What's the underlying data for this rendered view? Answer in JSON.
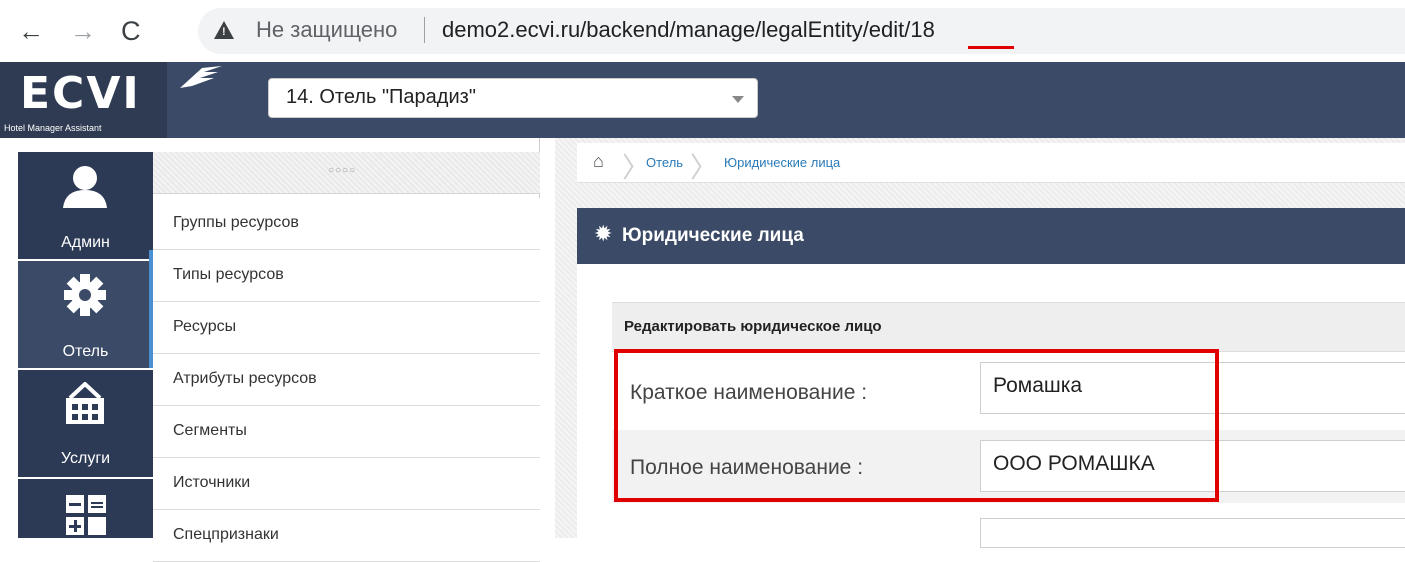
{
  "browser": {
    "back": "←",
    "forward": "→",
    "reload": "C",
    "security_label": "Не защищено",
    "url": "demo2.ecvi.ru/backend/manage/legalEntity/edit/18"
  },
  "header": {
    "logo": "ECVI",
    "logo_sub": "Hotel Manager Assistant",
    "hotel_select": "14. Отель \"Парадиз\""
  },
  "rail": {
    "items": [
      {
        "label": "Админ",
        "icon": "user-icon"
      },
      {
        "label": "Отель",
        "icon": "gear-icon"
      },
      {
        "label": "Услуги",
        "icon": "basket-icon"
      },
      {
        "label": "",
        "icon": "calculator-icon"
      }
    ]
  },
  "submenu": {
    "items": [
      {
        "label": "Группы ресурсов"
      },
      {
        "label": "Типы ресурсов"
      },
      {
        "label": "Ресурсы"
      },
      {
        "label": "Атрибуты ресурсов"
      },
      {
        "label": "Сегменты"
      },
      {
        "label": "Источники"
      },
      {
        "label": "Спецпризнаки"
      }
    ]
  },
  "breadcrumb": {
    "items": [
      "Отель",
      "Юридические лица"
    ]
  },
  "panel": {
    "title": "Юридические лица",
    "form_title": "Редактировать юридическое лицо",
    "fields": [
      {
        "label": "Краткое наименование :",
        "value": "Ромашка"
      },
      {
        "label": "Полное наименование :",
        "value": "ООО РОМАШКА"
      }
    ]
  },
  "colors": {
    "header": "#3b4a66",
    "rail": "#2c3a55",
    "accent": "#4a8fd1",
    "highlight": "#e00000"
  }
}
